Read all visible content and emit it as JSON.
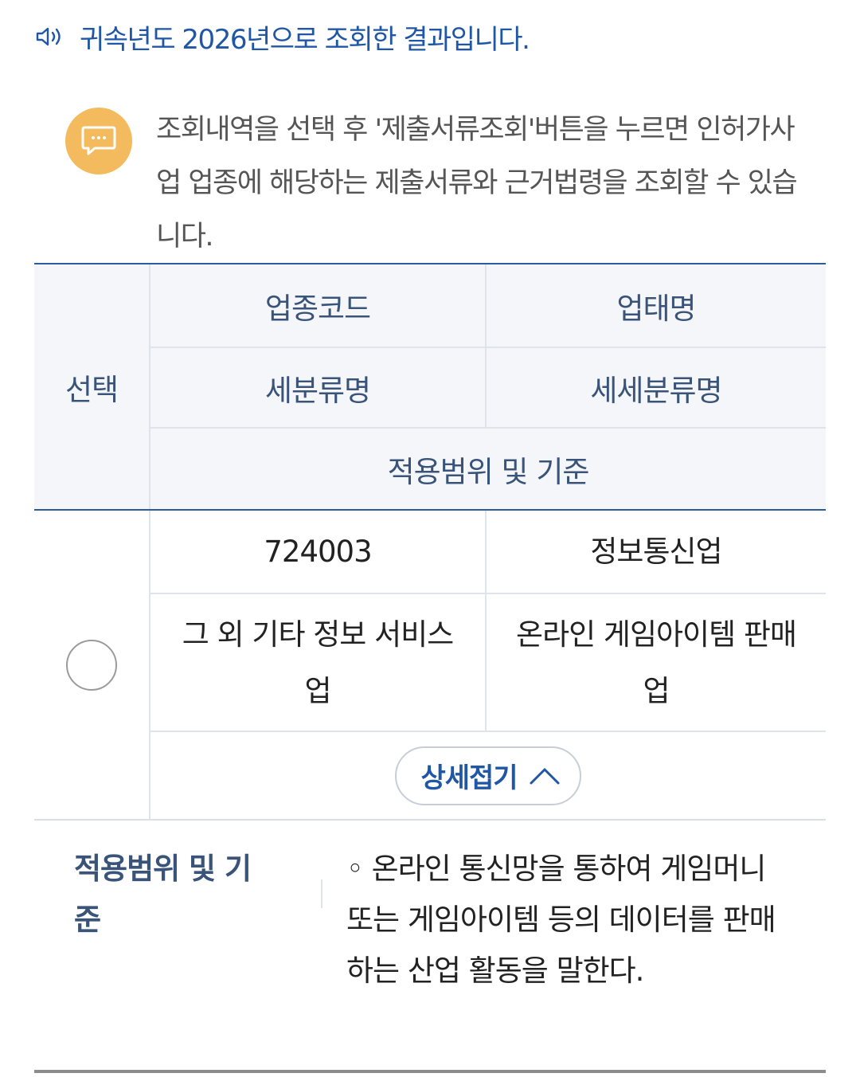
{
  "result": {
    "icon": "speaker-icon",
    "text": "귀속년도 2026년으로 조회한 결과입니다."
  },
  "notice": {
    "icon": "chat-bubble-icon",
    "text": "조회내역을 선택 후 '제출서류조회'버튼을 누르면 인허가사업 업종에 해당하는 제출서류와 근거법령을 조회할 수 있습니다."
  },
  "table": {
    "headers": {
      "select": "선택",
      "code": "업종코드",
      "business_name": "업태명",
      "subclass": "세분류명",
      "detail_subclass": "세세분류명",
      "scope": "적용범위 및 기준"
    },
    "row": {
      "code": "724003",
      "business_name": "정보통신업",
      "subclass": "그 외 기타 정보 서비스업",
      "detail_subclass": "온라인 게임아이템 판매업",
      "selected": false,
      "toggle_label": "상세접기",
      "toggle_icon": "chevron-up-icon"
    }
  },
  "detail": {
    "label": "적용범위 및 기준",
    "text": "◦ 온라인 통신망을 통하여 게임머니 또는 게임아이템 등의 데이터를 판매하는 산업 활동을 말한다."
  },
  "colors": {
    "accent_blue": "#1f56a6",
    "header_text": "#3a5378",
    "header_bg": "#f4f6fa",
    "notice_icon_bg": "#f3bb5d"
  }
}
